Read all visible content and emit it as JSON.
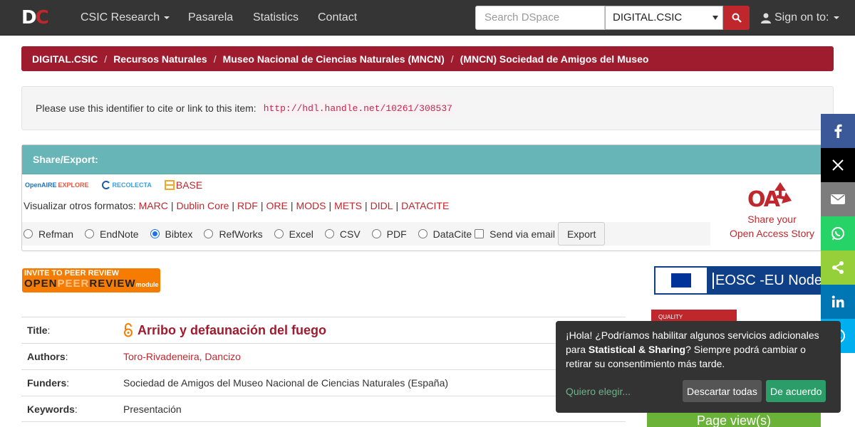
{
  "navbar": {
    "logo_d": "D",
    "logo_c": "C",
    "items": [
      "CSIC Research",
      "Pasarela",
      "Statistics",
      "Contact"
    ],
    "search_placeholder": "Search DSpace",
    "scope_selected": "DIGITAL.CSIC",
    "signon_label": "Sign on to:"
  },
  "breadcrumb": [
    "DIGITAL.CSIC",
    "Recursos Naturales",
    "Museo Nacional de Ciencias Naturales (MNCN)",
    "(MNCN) Sociedad de Amigos del Museo"
  ],
  "identifier": {
    "label": "Please use this identifier to cite or link to this item:",
    "handle": "http://hdl.handle.net/10261/308537"
  },
  "share": {
    "heading": "Share/Export:",
    "openaire": "OpenAIRE",
    "openaire_explore": "EXPLORE",
    "recolecta": "RECOLECTA",
    "base": "BASE",
    "formats_label": "Visualizar otros formatos:",
    "formats": [
      "MARC",
      "Dublin Core",
      "RDF",
      "ORE",
      "MODS",
      "METS",
      "DIDL",
      "DATACITE"
    ],
    "export_options": [
      "Refman",
      "EndNote",
      "Bibtex",
      "RefWorks",
      "Excel",
      "CSV",
      "PDF",
      "DataCite"
    ],
    "selected_export": "Bibtex",
    "send_email_label": "Send via email",
    "export_button": "Export",
    "oa_logo": "OA",
    "oa_text_1": "Share your",
    "oa_text_2": "Open Access Story"
  },
  "peer_review": {
    "line1": "INVITE TO PEER REVIEW",
    "line2_a": "OPEN",
    "line2_b": "PEER",
    "line2_c": "REVIEW",
    "line2_d": "module"
  },
  "metadata": {
    "title_label": "Title",
    "title_value": "Arribo y defaunación del fuego",
    "authors_label": "Authors",
    "authors_value": "Toro-Rivadeneira, Dancizo",
    "funders_label": "Funders",
    "funders_value": "Sociedad de Amigos del Museo Nacional de Ciencias Naturales (España)",
    "keywords_label": "Keywords",
    "keywords_value": "Presentación"
  },
  "sidebar": {
    "eosc_text": "EOSC -EU Node",
    "quality_text": "QUALITY",
    "pageviews": "Page view(s)"
  },
  "cookie": {
    "text_a": "¡Hola! ¿Podríamos habilitar algunos servicios adicionales para ",
    "text_bold": "Statistical & Sharing",
    "text_b": "? Siempre podrá cambiar o retirar su consentimiento más tarde.",
    "choose": "Quiero elegir...",
    "decline": "Descartar todas",
    "accept": "De acuerdo"
  },
  "colors": {
    "brand_red": "#9f1b2e",
    "link_red": "#c0272d",
    "panel_teal": "#67b5b7",
    "facebook": "#3b5998",
    "x": "#000000",
    "email": "#7d7d7d",
    "whatsapp": "#25d366",
    "sharethis": "#95d03a",
    "linkedin": "#0077b5",
    "skype": "#00aff0"
  }
}
